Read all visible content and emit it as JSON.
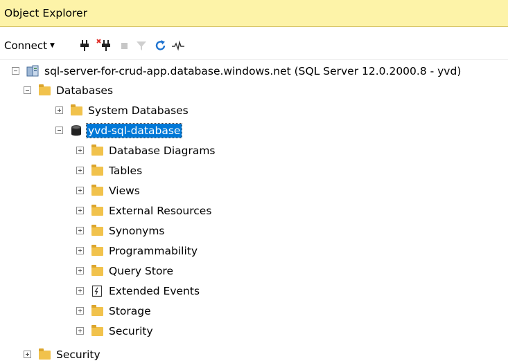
{
  "panel": {
    "title": "Object Explorer"
  },
  "toolbar": {
    "connect_label": "Connect",
    "icons": [
      "connect-plug-icon",
      "disconnect-plug-icon",
      "stop-icon",
      "filter-icon",
      "refresh-icon",
      "activity-monitor-icon"
    ]
  },
  "tree": {
    "server": "sql-server-for-crud-app.database.windows.net (SQL Server 12.0.2000.8 - yvd)",
    "databases": "Databases",
    "system_databases": "System Databases",
    "database": "yvd-sql-database",
    "children": [
      "Database Diagrams",
      "Tables",
      "Views",
      "External Resources",
      "Synonyms",
      "Programmability",
      "Query Store",
      "Extended Events",
      "Storage",
      "Security"
    ],
    "server_security": "Security"
  },
  "colors": {
    "title_bg": "#fdf3a8",
    "selection": "#0078d7",
    "folder": "#f1c24c"
  }
}
